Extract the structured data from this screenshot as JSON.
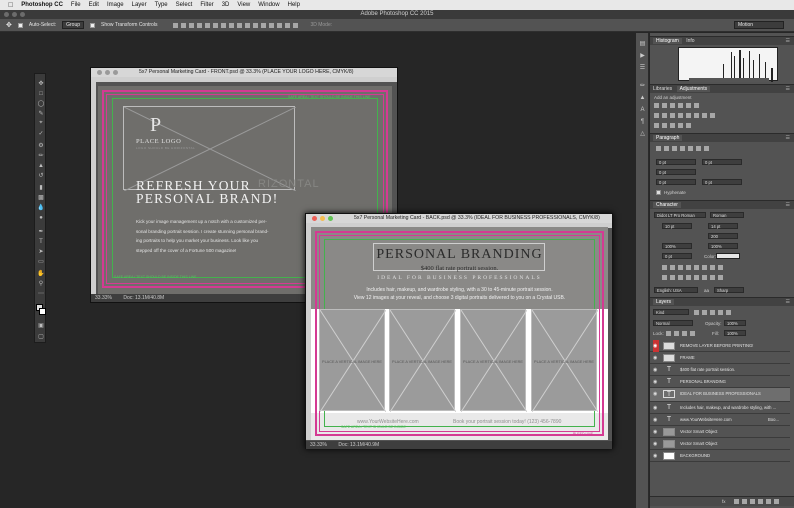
{
  "menubar": {
    "apple": "",
    "app": "Photoshop CC",
    "items": [
      "File",
      "Edit",
      "Image",
      "Layer",
      "Type",
      "Select",
      "Filter",
      "3D",
      "View",
      "Window",
      "Help"
    ]
  },
  "window_title": "Adobe Photoshop CC 2015",
  "options": {
    "auto_select": "Auto-Select:",
    "group": "Group",
    "show_transform": "Show Transform Controls",
    "mode_3d": "3D Mode:",
    "motion": "Motion"
  },
  "front_doc": {
    "title": "5x7 Personal Marketing Card - FRONT.psd @ 33.3% (PLACE YOUR LOGO HERE, CMYK/8)",
    "logo_letter": "P",
    "logo_text": "PLACE LOGO",
    "logo_sub": "LOGO SHOULD BE HORIZONTAL",
    "headline_1": "REFRESH YOUR",
    "headline_2": "PERSONAL BRAND!",
    "body_lines": [
      "Kick your image management up a notch with a customized per-",
      "sonal branding portrait session. I create stunning personal brand-",
      "ing portraits to help you market your business. Look like you",
      "stepped off the cover of a Fortune 500 magazine!"
    ],
    "ghost_text": "RIZONTAL",
    "guide_top": "SAFE AREA / TEXT SHOULD BE INSIDE THIS LINE",
    "guide_bottom": "SAFE AREA / TEXT SHOULD BE INSIDE THIS LINE",
    "zoom": "33.33%",
    "doc_size": "Doc: 13.1M/40.8M"
  },
  "back_doc": {
    "title": "5x7 Personal Marketing Card - BACK.psd @ 33.3% (IDEAL FOR BUSINESS PROFESSIONALS, CMYK/8)",
    "headline": "PERSONAL BRANDING",
    "price": "$400 flat rate portrait session.",
    "sub": "IDEAL FOR BUSINESS PROFESSIONALS",
    "body_1": "Includes hair, makeup, and wardrobe styling, with a 30 to 45-minute portrait session.",
    "body_2": "View 12 images at your reveal, and choose 3 digital portraits delivered to you on a Crystal USB.",
    "photo_label": "PLACE A VERTICAL IMAGE HERE",
    "website": "www.YourWebsiteHere.com",
    "cta": "Book your portrait session today! (123) 456-7890",
    "guide_left": "SAFE AREA / TEXT SHOULD BE INSIDE",
    "guide_bleed": "BLEED LINE",
    "zoom": "33.33%",
    "doc_size": "Doc: 13.1M/40.9M"
  },
  "panels": {
    "histogram_tab": "Histogram",
    "info_tab": "Info",
    "libraries_tab": "Libraries",
    "adjustments_tab": "Adjustments",
    "add_adjustment": "Add an adjustment",
    "paragraph_tab": "Paragraph",
    "para_fields": [
      "0 pt",
      "0 pt",
      "0 pt",
      "0 pt",
      "0 pt"
    ],
    "hyphenate": "Hyphenate",
    "character_tab": "Character",
    "font": "Didot LT Pro Roman",
    "style": "Roman",
    "size": "10 pt",
    "leading": "14 pt",
    "tracking": "200",
    "scale_v": "100%",
    "scale_h": "100%",
    "baseline": "0 pt",
    "color_label": "Color:",
    "language": "English: USA",
    "aa": "aa",
    "sharp": "Sharp",
    "layers_tab": "Layers",
    "kind": "Kind",
    "blend": "Normal",
    "opacity_label": "Opacity:",
    "opacity": "100%",
    "lock_label": "Lock:",
    "fill_label": "Fill:",
    "fill": "100%",
    "layers": [
      {
        "name": "REMOVE LAYER BEFORE PRINTING!",
        "kind": "img"
      },
      {
        "name": "FRAME",
        "kind": "img"
      },
      {
        "name": "$400 flat rate portrait session.",
        "kind": "T"
      },
      {
        "name": "PERSONAL BRANDING",
        "kind": "T"
      },
      {
        "name": "IDEAL FOR BUSINESS PROFESSIONALS",
        "kind": "T"
      },
      {
        "name": "Includes hair, makeup, and wardrobe styling, with ...",
        "kind": "T"
      },
      {
        "name": "www.YourWebsiteHere.com",
        "kind": "T",
        "suffix": "Boo..."
      },
      {
        "name": "Vector Smart Object",
        "kind": "img"
      },
      {
        "name": "Vector Smart Object",
        "kind": "img"
      },
      {
        "name": "BACKGROUND",
        "kind": "img"
      }
    ],
    "footer_icons": "fx"
  },
  "colors": {
    "pink_guide": "#d43a93",
    "green_guide": "#43b24d",
    "app_bg": "#262626",
    "panel_bg": "#535353"
  }
}
